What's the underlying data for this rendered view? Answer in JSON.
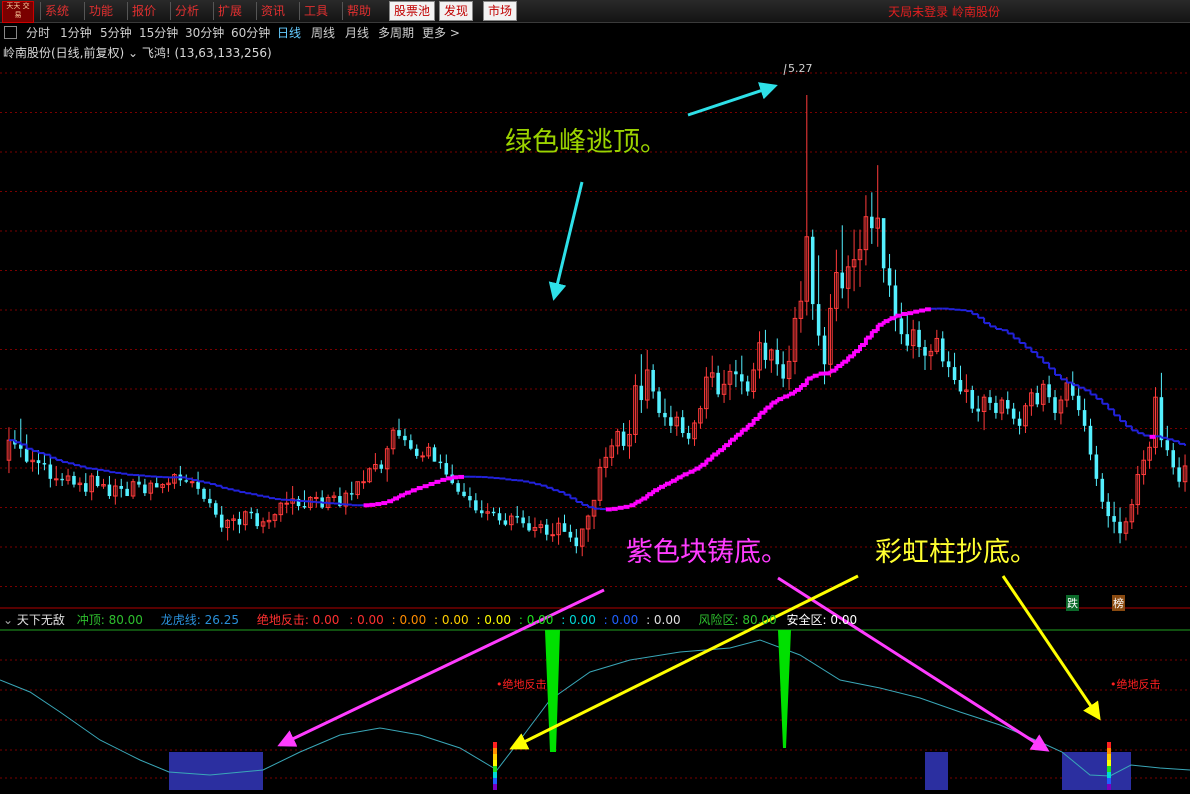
{
  "menu": {
    "logo_text": "天天\n交易",
    "items": [
      "系统",
      "功能",
      "报价",
      "分析",
      "扩展",
      "资讯",
      "工具",
      "帮助"
    ],
    "boxed_items": [
      "股票池",
      "发现",
      "市场"
    ],
    "status_text": "天局未登录 岭南股份"
  },
  "timeframes": {
    "items": [
      "分时",
      "1分钟",
      "5分钟",
      "15分钟",
      "30分钟",
      "60分钟",
      "日线",
      "周线",
      "月线",
      "多周期",
      "更多 >"
    ],
    "active": "日线"
  },
  "title_line": "岭南股份(日线,前复权) ⌄ 飞鸿! (13,63,133,256)",
  "price_peak_label": "5.27",
  "annotations": {
    "green_peak": "绿色峰逃顶。",
    "purple_block": "紫色块铸底。",
    "rainbow": "彩虹柱抄底。"
  },
  "signals": {
    "die_badge": "跌",
    "bang_badge": "榜",
    "juedi_label_1": "•绝地反击",
    "juedi_label_2": "•绝地反击"
  },
  "indicator_line": {
    "name": "天下无敌",
    "chongding": "冲顶: 80.00",
    "longhu": "龙虎线: 26.25",
    "juedi": "绝地反击: 0.00",
    "v1": ": 0.00",
    "v2": ": 0.00",
    "v3": ": 0.00",
    "v4": ": 0.00",
    "v5": ": 0.00",
    "v6": ": 0.00",
    "v7": ": 0.00",
    "v8": ": 0.00",
    "fengxian": "风险区: 80.00",
    "anquan": "安全区: 0.00"
  },
  "colors": {
    "up": "#ff3b3b",
    "down": "#54f0ff",
    "ma": "#2222dd",
    "ma_up": "#ff00ff",
    "grid": "#7a0000",
    "green_peak": "#9bd300",
    "magenta": "#ff3cff",
    "yellow": "#ffff00",
    "cyan_arrow": "#2ee0e8",
    "purple_block": "#2b2fa0",
    "osc": "#3aa7b8",
    "green_spike": "#00e000"
  },
  "chart_data": {
    "type": "candlestick",
    "ylim": [
      1.8,
      5.5
    ],
    "peak_value": 5.27,
    "candles": [
      [
        2.72,
        2.95,
        2.63,
        2.86
      ],
      [
        2.86,
        2.93,
        2.8,
        2.83
      ],
      [
        2.83,
        3.01,
        2.74,
        2.8
      ],
      [
        2.8,
        2.9,
        2.7,
        2.71
      ],
      [
        2.71,
        2.79,
        2.64,
        2.72
      ],
      [
        2.72,
        2.79,
        2.62,
        2.7
      ],
      [
        2.7,
        2.77,
        2.65,
        2.69
      ],
      [
        2.69,
        2.74,
        2.53,
        2.59
      ],
      [
        2.59,
        2.68,
        2.54,
        2.59
      ],
      [
        2.59,
        2.63,
        2.54,
        2.58
      ],
      [
        2.58,
        2.66,
        2.55,
        2.61
      ],
      [
        2.61,
        2.64,
        2.53,
        2.55
      ],
      [
        2.55,
        2.6,
        2.5,
        2.56
      ],
      [
        2.56,
        2.63,
        2.47,
        2.5
      ],
      [
        2.5,
        2.63,
        2.44,
        2.61
      ],
      [
        2.61,
        2.65,
        2.53,
        2.54
      ],
      [
        2.54,
        2.59,
        2.52,
        2.55
      ],
      [
        2.55,
        2.61,
        2.45,
        2.47
      ],
      [
        2.47,
        2.59,
        2.41,
        2.54
      ],
      [
        2.54,
        2.59,
        2.46,
        2.52
      ],
      [
        2.52,
        2.57,
        2.47,
        2.47
      ],
      [
        2.47,
        2.59,
        2.45,
        2.57
      ],
      [
        2.57,
        2.62,
        2.53,
        2.55
      ],
      [
        2.55,
        2.59,
        2.47,
        2.49
      ],
      [
        2.49,
        2.58,
        2.44,
        2.56
      ],
      [
        2.56,
        2.6,
        2.53,
        2.53
      ],
      [
        2.53,
        2.56,
        2.49,
        2.55
      ],
      [
        2.55,
        2.6,
        2.5,
        2.56
      ],
      [
        2.56,
        2.63,
        2.52,
        2.62
      ],
      [
        2.62,
        2.68,
        2.54,
        2.58
      ],
      [
        2.58,
        2.62,
        2.56,
        2.57
      ],
      [
        2.57,
        2.6,
        2.53,
        2.57
      ],
      [
        2.57,
        2.64,
        2.48,
        2.52
      ],
      [
        2.52,
        2.53,
        2.43,
        2.45
      ],
      [
        2.45,
        2.52,
        2.39,
        2.42
      ],
      [
        2.42,
        2.44,
        2.32,
        2.34
      ],
      [
        2.34,
        2.4,
        2.22,
        2.25
      ],
      [
        2.25,
        2.31,
        2.16,
        2.3
      ],
      [
        2.3,
        2.34,
        2.23,
        2.31
      ],
      [
        2.31,
        2.36,
        2.21,
        2.27
      ],
      [
        2.27,
        2.37,
        2.23,
        2.36
      ],
      [
        2.36,
        2.39,
        2.31,
        2.35
      ],
      [
        2.35,
        2.38,
        2.24,
        2.26
      ],
      [
        2.26,
        2.32,
        2.21,
        2.29
      ],
      [
        2.29,
        2.36,
        2.24,
        2.3
      ],
      [
        2.3,
        2.35,
        2.25,
        2.34
      ],
      [
        2.34,
        2.43,
        2.29,
        2.42
      ],
      [
        2.42,
        2.5,
        2.35,
        2.42
      ],
      [
        2.42,
        2.54,
        2.34,
        2.45
      ],
      [
        2.45,
        2.47,
        2.37,
        2.4
      ],
      [
        2.4,
        2.51,
        2.38,
        2.39
      ],
      [
        2.39,
        2.47,
        2.37,
        2.46
      ],
      [
        2.46,
        2.5,
        2.39,
        2.46
      ],
      [
        2.46,
        2.51,
        2.38,
        2.39
      ],
      [
        2.39,
        2.48,
        2.37,
        2.46
      ],
      [
        2.46,
        2.5,
        2.43,
        2.47
      ],
      [
        2.47,
        2.53,
        2.39,
        2.4
      ],
      [
        2.4,
        2.51,
        2.34,
        2.49
      ],
      [
        2.49,
        2.57,
        2.44,
        2.48
      ],
      [
        2.48,
        2.57,
        2.45,
        2.57
      ],
      [
        2.57,
        2.65,
        2.52,
        2.57
      ],
      [
        2.57,
        2.67,
        2.56,
        2.66
      ],
      [
        2.66,
        2.77,
        2.64,
        2.69
      ],
      [
        2.69,
        2.72,
        2.63,
        2.66
      ],
      [
        2.66,
        2.82,
        2.57,
        2.8
      ],
      [
        2.8,
        2.95,
        2.76,
        2.93
      ],
      [
        2.93,
        3.01,
        2.87,
        2.89
      ],
      [
        2.89,
        2.94,
        2.82,
        2.86
      ],
      [
        2.86,
        2.9,
        2.79,
        2.8
      ],
      [
        2.8,
        2.83,
        2.73,
        2.75
      ],
      [
        2.75,
        2.78,
        2.71,
        2.75
      ],
      [
        2.75,
        2.84,
        2.73,
        2.81
      ],
      [
        2.81,
        2.83,
        2.71,
        2.71
      ],
      [
        2.71,
        2.76,
        2.66,
        2.7
      ],
      [
        2.7,
        2.76,
        2.6,
        2.62
      ],
      [
        2.62,
        2.69,
        2.55,
        2.56
      ],
      [
        2.56,
        2.58,
        2.48,
        2.5
      ],
      [
        2.5,
        2.56,
        2.46,
        2.47
      ],
      [
        2.47,
        2.53,
        2.39,
        2.44
      ],
      [
        2.44,
        2.49,
        2.35,
        2.37
      ],
      [
        2.37,
        2.44,
        2.32,
        2.35
      ],
      [
        2.35,
        2.42,
        2.3,
        2.36
      ],
      [
        2.36,
        2.39,
        2.33,
        2.35
      ],
      [
        2.35,
        2.39,
        2.27,
        2.3
      ],
      [
        2.3,
        2.35,
        2.26,
        2.27
      ],
      [
        2.27,
        2.35,
        2.23,
        2.33
      ],
      [
        2.33,
        2.4,
        2.28,
        2.32
      ],
      [
        2.32,
        2.37,
        2.25,
        2.28
      ],
      [
        2.28,
        2.33,
        2.22,
        2.23
      ],
      [
        2.23,
        2.32,
        2.18,
        2.25
      ],
      [
        2.25,
        2.3,
        2.21,
        2.27
      ],
      [
        2.27,
        2.31,
        2.16,
        2.2
      ],
      [
        2.2,
        2.28,
        2.15,
        2.2
      ],
      [
        2.2,
        2.32,
        2.13,
        2.28
      ],
      [
        2.28,
        2.34,
        2.22,
        2.22
      ],
      [
        2.22,
        2.27,
        2.15,
        2.18
      ],
      [
        2.18,
        2.24,
        2.07,
        2.12
      ],
      [
        2.12,
        2.24,
        2.05,
        2.24
      ],
      [
        2.24,
        2.34,
        2.15,
        2.33
      ],
      [
        2.33,
        2.44,
        2.24,
        2.44
      ],
      [
        2.44,
        2.73,
        2.4,
        2.67
      ],
      [
        2.67,
        2.81,
        2.6,
        2.74
      ],
      [
        2.74,
        2.87,
        2.68,
        2.82
      ],
      [
        2.82,
        2.94,
        2.76,
        2.92
      ],
      [
        2.92,
        2.98,
        2.79,
        2.82
      ],
      [
        2.82,
        3.0,
        2.73,
        2.9
      ],
      [
        2.9,
        3.32,
        2.84,
        3.24
      ],
      [
        3.24,
        3.46,
        3.05,
        3.14
      ],
      [
        3.14,
        3.49,
        3.08,
        3.35
      ],
      [
        3.35,
        3.39,
        3.15,
        3.2
      ],
      [
        3.2,
        3.23,
        3.02,
        3.05
      ],
      [
        3.05,
        3.15,
        2.96,
        3.02
      ],
      [
        3.02,
        3.1,
        2.91,
        2.96
      ],
      [
        2.96,
        3.06,
        2.89,
        3.02
      ],
      [
        3.02,
        3.07,
        2.88,
        2.91
      ],
      [
        2.91,
        2.96,
        2.83,
        2.87
      ],
      [
        2.87,
        3.0,
        2.82,
        2.98
      ],
      [
        2.98,
        3.1,
        2.94,
        3.08
      ],
      [
        3.08,
        3.37,
        3.01,
        3.3
      ],
      [
        3.3,
        3.45,
        3.23,
        3.33
      ],
      [
        3.33,
        3.38,
        3.16,
        3.18
      ],
      [
        3.18,
        3.35,
        3.12,
        3.25
      ],
      [
        3.25,
        3.39,
        3.14,
        3.34
      ],
      [
        3.34,
        3.42,
        3.23,
        3.32
      ],
      [
        3.32,
        3.45,
        3.18,
        3.27
      ],
      [
        3.27,
        3.31,
        3.17,
        3.2
      ],
      [
        3.2,
        3.4,
        3.15,
        3.35
      ],
      [
        3.35,
        3.62,
        3.29,
        3.54
      ],
      [
        3.54,
        3.63,
        3.36,
        3.42
      ],
      [
        3.42,
        3.5,
        3.33,
        3.49
      ],
      [
        3.49,
        3.57,
        3.31,
        3.39
      ],
      [
        3.39,
        3.48,
        3.23,
        3.29
      ],
      [
        3.29,
        3.52,
        3.21,
        3.41
      ],
      [
        3.41,
        3.79,
        3.32,
        3.71
      ],
      [
        3.71,
        3.97,
        3.61,
        3.83
      ],
      [
        3.83,
        5.27,
        3.73,
        4.28
      ],
      [
        4.28,
        4.33,
        3.7,
        3.81
      ],
      [
        3.81,
        4.15,
        3.52,
        3.59
      ],
      [
        3.59,
        3.65,
        3.25,
        3.39
      ],
      [
        3.39,
        3.88,
        3.3,
        3.78
      ],
      [
        3.78,
        4.19,
        3.69,
        4.03
      ],
      [
        4.03,
        4.36,
        3.85,
        3.92
      ],
      [
        3.92,
        4.15,
        3.78,
        4.07
      ],
      [
        4.07,
        4.33,
        3.9,
        4.12
      ],
      [
        4.12,
        4.33,
        3.93,
        4.19
      ],
      [
        4.19,
        4.57,
        4.08,
        4.42
      ],
      [
        4.42,
        4.59,
        4.23,
        4.34
      ],
      [
        4.34,
        4.78,
        4.21,
        4.41
      ],
      [
        4.41,
        4.4,
        3.96,
        4.06
      ],
      [
        4.06,
        4.16,
        3.86,
        3.94
      ],
      [
        3.94,
        4.05,
        3.62,
        3.71
      ],
      [
        3.71,
        3.82,
        3.53,
        3.6
      ],
      [
        3.6,
        3.74,
        3.48,
        3.52
      ],
      [
        3.52,
        3.7,
        3.43,
        3.63
      ],
      [
        3.63,
        3.69,
        3.44,
        3.51
      ],
      [
        3.51,
        3.56,
        3.35,
        3.45
      ],
      [
        3.45,
        3.53,
        3.35,
        3.48
      ],
      [
        3.48,
        3.63,
        3.46,
        3.57
      ],
      [
        3.57,
        3.62,
        3.37,
        3.41
      ],
      [
        3.41,
        3.48,
        3.3,
        3.37
      ],
      [
        3.37,
        3.47,
        3.25,
        3.28
      ],
      [
        3.28,
        3.38,
        3.18,
        3.2
      ],
      [
        3.2,
        3.32,
        3.12,
        3.21
      ],
      [
        3.21,
        3.24,
        3.05,
        3.08
      ],
      [
        3.08,
        3.17,
        2.99,
        3.06
      ],
      [
        3.06,
        3.18,
        2.93,
        3.16
      ],
      [
        3.16,
        3.21,
        3.07,
        3.12
      ],
      [
        3.12,
        3.17,
        3.01,
        3.05
      ],
      [
        3.05,
        3.16,
        3.0,
        3.14
      ],
      [
        3.14,
        3.2,
        3.04,
        3.08
      ],
      [
        3.08,
        3.12,
        2.97,
        3.01
      ],
      [
        3.01,
        3.06,
        2.9,
        2.96
      ],
      [
        2.96,
        3.12,
        2.91,
        3.1
      ],
      [
        3.1,
        3.22,
        3.03,
        3.19
      ],
      [
        3.19,
        3.24,
        3.09,
        3.11
      ],
      [
        3.11,
        3.28,
        3.06,
        3.25
      ],
      [
        3.25,
        3.31,
        3.12,
        3.16
      ],
      [
        3.16,
        3.21,
        3.0,
        3.05
      ],
      [
        3.05,
        3.17,
        2.97,
        3.14
      ],
      [
        3.14,
        3.3,
        3.09,
        3.26
      ],
      [
        3.26,
        3.34,
        3.14,
        3.17
      ],
      [
        3.17,
        3.24,
        3.03,
        3.07
      ],
      [
        3.07,
        3.15,
        2.92,
        2.96
      ],
      [
        2.96,
        3.01,
        2.72,
        2.76
      ],
      [
        2.76,
        2.82,
        2.54,
        2.59
      ],
      [
        2.59,
        2.63,
        2.38,
        2.43
      ],
      [
        2.43,
        2.49,
        2.25,
        2.33
      ],
      [
        2.33,
        2.43,
        2.21,
        2.29
      ],
      [
        2.29,
        2.39,
        2.14,
        2.21
      ],
      [
        2.21,
        2.32,
        2.16,
        2.29
      ],
      [
        2.29,
        2.45,
        2.24,
        2.41
      ],
      [
        2.41,
        2.68,
        2.34,
        2.62
      ],
      [
        2.62,
        2.79,
        2.55,
        2.72
      ],
      [
        2.72,
        2.85,
        2.66,
        2.81
      ],
      [
        2.81,
        3.23,
        2.76,
        3.16
      ],
      [
        3.16,
        3.33,
        2.81,
        2.86
      ],
      [
        2.86,
        2.96,
        2.75,
        2.79
      ],
      [
        2.79,
        2.84,
        2.62,
        2.67
      ],
      [
        2.67,
        2.74,
        2.53,
        2.57
      ],
      [
        2.57,
        2.76,
        2.5,
        2.68
      ]
    ]
  }
}
